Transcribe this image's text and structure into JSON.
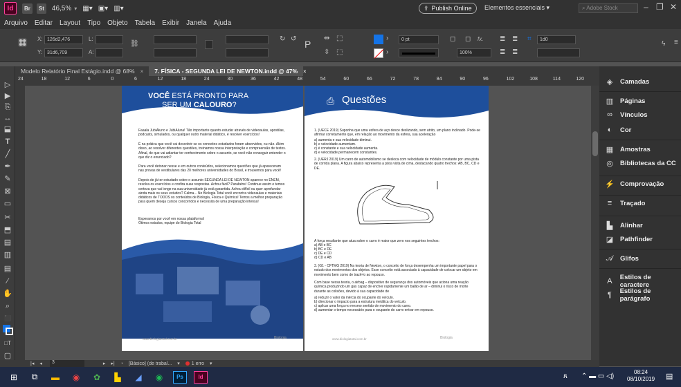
{
  "titlebar": {
    "app_badge": "Id",
    "bridge": "Br",
    "stock": "St",
    "zoom": "46,5%",
    "publish_label": "Publish Online",
    "workspace": "Elementos essenciais",
    "search_placeholder": "Adobe Stock"
  },
  "menu": [
    "Arquivo",
    "Editar",
    "Layout",
    "Tipo",
    "Objeto",
    "Tabela",
    "Exibir",
    "Janela",
    "Ajuda"
  ],
  "control": {
    "x_label": "X:",
    "x_value": "126d2,476",
    "y_label": "Y:",
    "y_value": "31d6,709",
    "w_label": "L:",
    "h_label": "A:",
    "stroke_pt": "0 pt",
    "opacity": "100%",
    "fx_label": "fx.",
    "size_value": "1d0"
  },
  "tabs": [
    {
      "label": "Modelo Relatório Final Estágio.indd @ 68%"
    },
    {
      "label": "7. FÍSICA - SEGUNDA LEI DE NEWTON.indd @ 47%"
    }
  ],
  "ruler_ticks": [
    "24",
    "18",
    "12",
    "6",
    "0",
    "6",
    "12",
    "18",
    "24",
    "30",
    "36",
    "42",
    "48",
    "54",
    "60",
    "66",
    "72",
    "78",
    "84",
    "90",
    "96",
    "102",
    "108",
    "114",
    "120"
  ],
  "left_page": {
    "heading_pre": "VOCÊ",
    "heading_mid": " ESTÁ PRONTO PARA",
    "heading_line2_pre": "SER UM ",
    "heading_line2_bold": "CALOURO",
    "heading_line2_q": "?",
    "para1": "Faaala JubiAluno e JubiAluna! Tão importante quanto estudar através de videoaulas, apostilas, podcasts, simulados, ou qualquer outro material didático, é resolver exercícios!",
    "para2": "É na prática que você vai descobrir se os conceitos estudados foram absorvidos, ou não. Além disso, ao resolver diferentes questões, treinamos nossa interpretação e compreensão de textos. Afinal, de que vai adiantar ter conhecimento sobre o assunto, se você não conseguir entender o que diz o enunciado?",
    "para3": "Para você detonar nesse e em outros conteúdos, selecionamos questões que já apareceram nas provas de vestibulares das 20 melhores universidades do Brasil, e trouxemos para você!",
    "para4": "Depois de já ter estudado sobre o assunto SEGUNDA LEI DE NEWTON aparece no ENEM, resolva os exercícios e confira suas respostas. Achou fácil? Parabéns! Continue assim e temos certeza que vai longe na sua universidade já está garantida. Achou difícil ou quer aprofundar ainda mais os seus estudos? Calma... No Biologia Total você encontra videoaulas e materiais didáticos de TODOS os conteúdos de Biologia, Física e Química! Temos a melhor preparação para quem deseja cursos concorridos e necessita de uma preparação intensa!",
    "sign1": "Esperamos por você em nossa plataforma!",
    "sign2": "Ótimos estudos, equipe do Biologia Total",
    "footer_url": "www.biologiatotal.com.br",
    "footer_logo": "Biologia"
  },
  "right_page": {
    "title": "Questões",
    "q1": "1. (UECE 2019) Suponha que uma esfera de aço desce deslizando, sem atrito, um plano inclinado. Pode-se afirmar corretamente que, em relação ao movimento da esfera, sua aceleração",
    "q1a": "a) aumenta e sua velocidade diminui.",
    "q1b": "b) e velocidade aumentam.",
    "q1c": "c) é constante e sua velocidade aumenta.",
    "q1d": "d) e velocidade permanecem constantes.",
    "q2": "2. (UERJ 2019) Um carro de automobilismo se desloca com velocidade de módulo constante por uma pista de corrida plana. A figura abaixo representa a pista vista de cima, destacando quatro trechos: AB, BC, CD e DE.",
    "q2_question": "A força resultante que atua sobre o carro é maior que zero nos seguintes trechos:",
    "q2a": "a) AB e BC",
    "q2b": "b) BC e DE",
    "q2c": "c) DE e CD",
    "q2d": "d) CD e AB",
    "q3": "3. (G1 - CFTMG 2019) Na teoria de Newton, o conceito de força desempenha um importante papel para o estudo dos movimentos dos objetos. Esse conceito está associado à capacidade de colocar um objeto em movimento bem como de trazê-lo ao repouso.",
    "q3b": "Com base nessa teoria, o airbag – dispositivo de segurança dos automóveis que aciona uma reação química produzindo um gás capaz de encher rapidamente um balão de ar – diminui o risco de morte durante as colisões, devido à sua capacidade de",
    "q3a_opt": "a) reduzir o valor da inércia do ocupante do veículo.",
    "q3b_opt": "b) direcionar o impacto para a estrutura metálica do veículo.",
    "q3c_opt": "c) aplicar uma força no mesmo sentido de movimento do carro.",
    "q3d_opt": "d) aumentar o tempo necessário para o ocupante do carro entrar em repouso.",
    "footer_url": "www.biologiatotal.com.br",
    "footer_logo": "Biologia"
  },
  "panels": [
    {
      "label": "Camadas",
      "icon": "layers-icon"
    },
    {
      "label": "Páginas",
      "icon": "pages-icon"
    },
    {
      "label": "Vínculos",
      "icon": "links-icon"
    },
    {
      "label": "Cor",
      "icon": "color-icon"
    },
    {
      "label": "Amostras",
      "icon": "swatches-icon"
    },
    {
      "label": "Bibliotecas da CC",
      "icon": "cc-libraries-icon"
    },
    {
      "label": "Comprovação",
      "icon": "preflight-icon"
    },
    {
      "label": "Traçado",
      "icon": "stroke-icon"
    },
    {
      "label": "Alinhar",
      "icon": "align-icon"
    },
    {
      "label": "Pathfinder",
      "icon": "pathfinder-icon"
    },
    {
      "label": "Glifos",
      "icon": "glyphs-icon"
    },
    {
      "label": "Estilos de caractere",
      "icon": "char-styles-icon"
    },
    {
      "label": "Estilos de parágrafo",
      "icon": "para-styles-icon"
    }
  ],
  "status": {
    "page": "3",
    "style": "[Básico] (de trabal...",
    "errors": "1 erro"
  },
  "taskbar": {
    "time": "08:24",
    "date": "08/10/2019"
  },
  "colors": {
    "blue": "#1e4f9c",
    "dark_blue": "#173d7a",
    "accent": "#1473e6"
  }
}
